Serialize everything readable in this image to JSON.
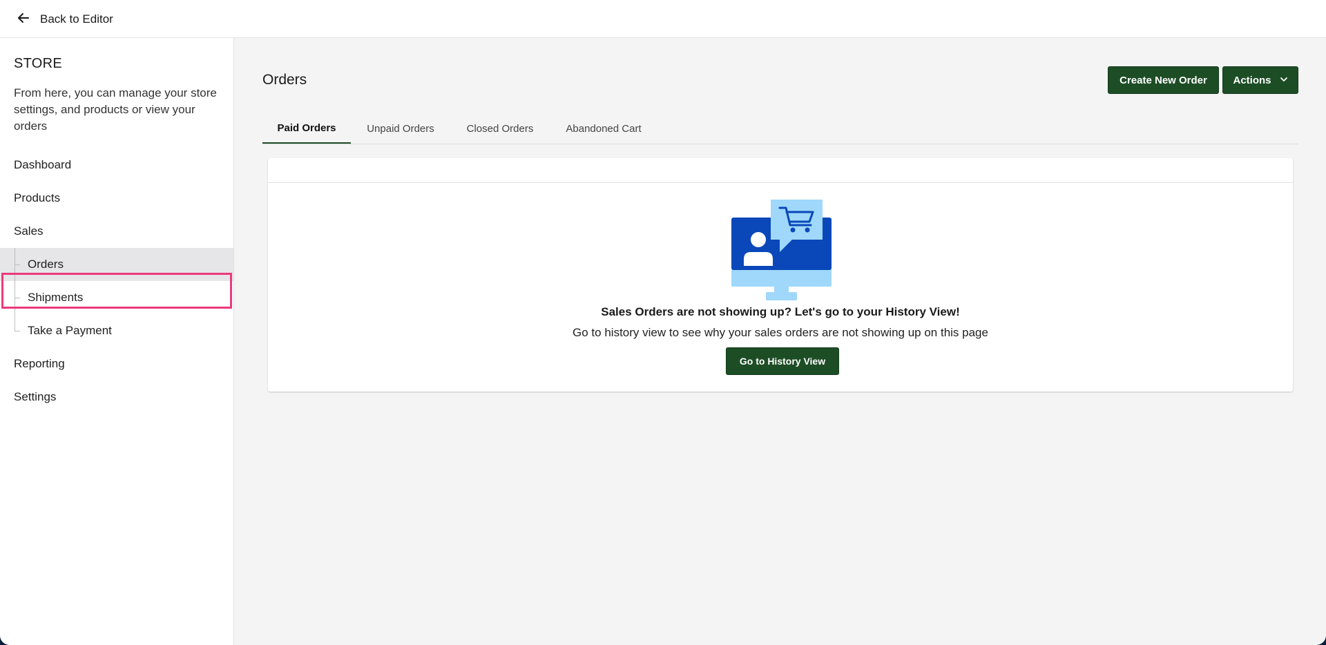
{
  "topbar": {
    "back_label": "Back to Editor"
  },
  "sidebar": {
    "title": "STORE",
    "description": "From here, you can manage your store settings, and products or view your orders",
    "items": [
      {
        "label": "Dashboard"
      },
      {
        "label": "Products"
      },
      {
        "label": "Sales"
      },
      {
        "label": "Orders"
      },
      {
        "label": "Shipments"
      },
      {
        "label": "Take a Payment"
      },
      {
        "label": "Reporting"
      },
      {
        "label": "Settings"
      }
    ]
  },
  "main": {
    "title": "Orders",
    "create_label": "Create New Order",
    "actions_label": "Actions",
    "tabs": [
      {
        "label": "Paid Orders"
      },
      {
        "label": "Unpaid Orders"
      },
      {
        "label": "Closed Orders"
      },
      {
        "label": "Abandoned Cart"
      }
    ],
    "empty": {
      "title": "Sales Orders are not showing up? Let's go to your History View!",
      "subtitle": "Go to history view to see why your sales orders are not showing up on this page",
      "button_label": "Go to History View"
    }
  },
  "colors": {
    "primary": "#1d4d25",
    "highlight": "#ec3a7c",
    "illustration_dark": "#0a47b9",
    "illustration_light": "#9fd8fb"
  },
  "icons": {
    "back": "arrow-left-icon",
    "actions": "chevron-down-icon",
    "illustration": "monitor-cart-illustration"
  }
}
